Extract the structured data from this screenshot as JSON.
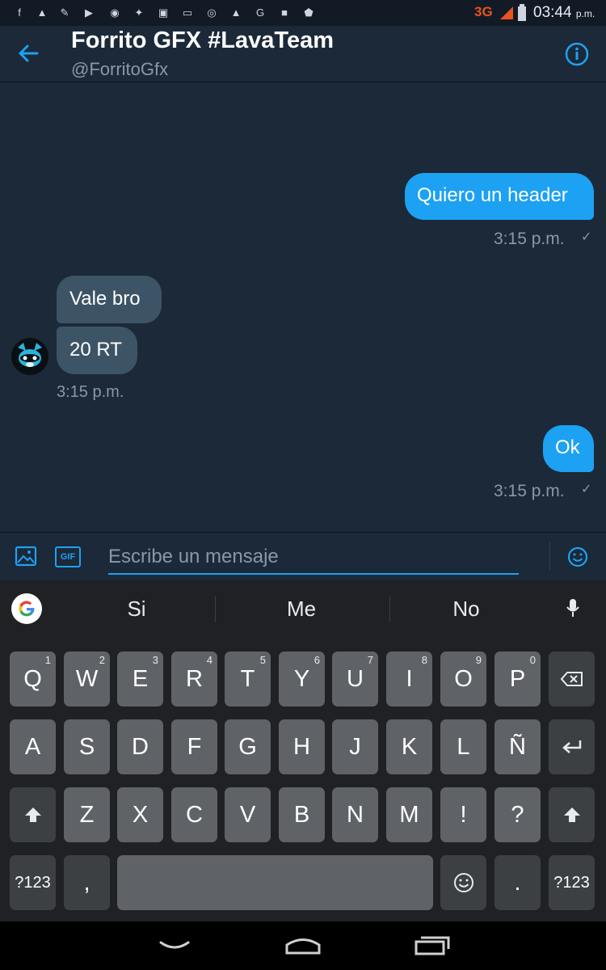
{
  "status_bar": {
    "network": "3G",
    "time": "03:44",
    "ampm": "p.m."
  },
  "header": {
    "title": "Forrito GFX #LavaTeam",
    "handle": "@ForritoGfx"
  },
  "messages": [
    {
      "text": "Quiero un header",
      "time": "3:15 p.m."
    },
    {
      "text": "Vale bro"
    },
    {
      "text": "20 RT",
      "time": "3:15 p.m."
    },
    {
      "text": "Ok",
      "time": "3:15 p.m."
    }
  ],
  "composer": {
    "placeholder": "Escribe un mensaje",
    "gif_label": "GIF"
  },
  "keyboard": {
    "suggestions": [
      "Si",
      "Me",
      "No"
    ],
    "row1": [
      "Q",
      "W",
      "E",
      "R",
      "T",
      "Y",
      "U",
      "I",
      "O",
      "P"
    ],
    "row1_hints": [
      "1",
      "2",
      "3",
      "4",
      "5",
      "6",
      "7",
      "8",
      "9",
      "0"
    ],
    "row2": [
      "A",
      "S",
      "D",
      "F",
      "G",
      "H",
      "J",
      "K",
      "L",
      "Ñ"
    ],
    "row3": [
      "Z",
      "X",
      "C",
      "V",
      "B",
      "N",
      "M",
      "!",
      "?"
    ],
    "symbols": "?123",
    "comma": ",",
    "period": "."
  },
  "colors": {
    "accent": "#1da1f2",
    "background": "#1c2938",
    "incoming_bubble": "#3d5466"
  }
}
